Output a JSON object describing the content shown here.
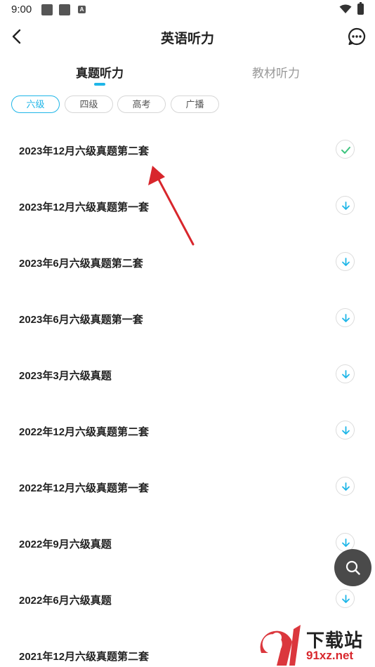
{
  "status_bar": {
    "time": "9:00",
    "notif_a": "A"
  },
  "header": {
    "title": "英语听力"
  },
  "tabs": [
    {
      "label": "真题听力",
      "active": true
    },
    {
      "label": "教材听力",
      "active": false
    }
  ],
  "chips": [
    {
      "label": "六级",
      "selected": true
    },
    {
      "label": "四级",
      "selected": false
    },
    {
      "label": "高考",
      "selected": false
    },
    {
      "label": "广播",
      "selected": false
    }
  ],
  "items": [
    {
      "title": "2023年12月六级真题第二套",
      "icon": "check-icon"
    },
    {
      "title": "2023年12月六级真题第一套",
      "icon": "download-icon"
    },
    {
      "title": "2023年6月六级真题第二套",
      "icon": "download-icon"
    },
    {
      "title": "2023年6月六级真题第一套",
      "icon": "download-icon"
    },
    {
      "title": "2023年3月六级真题",
      "icon": "download-icon"
    },
    {
      "title": "2022年12月六级真题第二套",
      "icon": "download-icon"
    },
    {
      "title": "2022年12月六级真题第一套",
      "icon": "download-icon"
    },
    {
      "title": "2022年9月六级真题",
      "icon": "download-icon"
    },
    {
      "title": "2022年6月六级真题",
      "icon": "download-icon"
    },
    {
      "title": "2021年12月六级真题第二套",
      "icon": "download-icon"
    }
  ],
  "watermark": {
    "brand": "下载站",
    "domain": "91xz.net"
  },
  "colors": {
    "accent": "#1fb6e8",
    "check": "#3dc47e",
    "arrow": "#d8262c",
    "fab": "#4a4a4a"
  }
}
